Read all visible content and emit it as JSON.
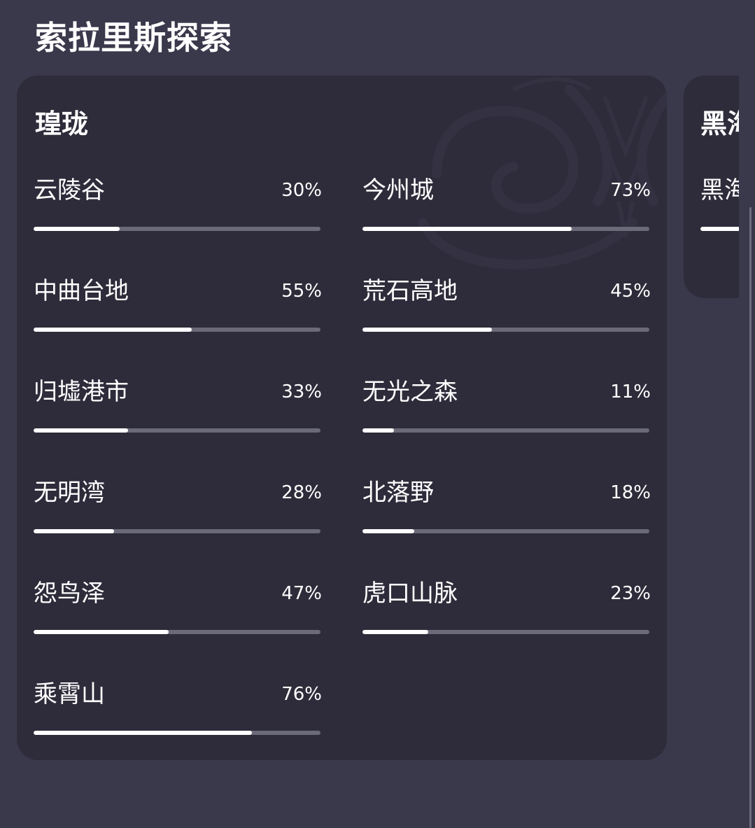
{
  "page": {
    "title": "索拉里斯探索"
  },
  "regions": [
    {
      "name": "瑝珑",
      "emblem": "serpent-dragon-emblem",
      "areas": [
        {
          "name": "云陵谷",
          "percent_label": "30%",
          "progress": 0.3
        },
        {
          "name": "今州城",
          "percent_label": "73%",
          "progress": 0.73
        },
        {
          "name": "中曲台地",
          "percent_label": "55%",
          "progress": 0.55
        },
        {
          "name": "荒石高地",
          "percent_label": "45%",
          "progress": 0.45
        },
        {
          "name": "归墟港市",
          "percent_label": "33%",
          "progress": 0.33
        },
        {
          "name": "无光之森",
          "percent_label": "11%",
          "progress": 0.11
        },
        {
          "name": "无明湾",
          "percent_label": "28%",
          "progress": 0.28
        },
        {
          "name": "北落野",
          "percent_label": "18%",
          "progress": 0.18
        },
        {
          "name": "怨鸟泽",
          "percent_label": "47%",
          "progress": 0.47
        },
        {
          "name": "虎口山脉",
          "percent_label": "23%",
          "progress": 0.23
        },
        {
          "name": "乘霄山",
          "percent_label": "76%",
          "progress": 0.76
        }
      ]
    },
    {
      "name": "黑海",
      "areas": [
        {
          "name": "黑海",
          "progress": 0.14
        }
      ]
    }
  ],
  "colors": {
    "background": "#3a384b",
    "card": "#2e2c3a",
    "track": "#6b6a78",
    "fill": "#ffffff"
  }
}
